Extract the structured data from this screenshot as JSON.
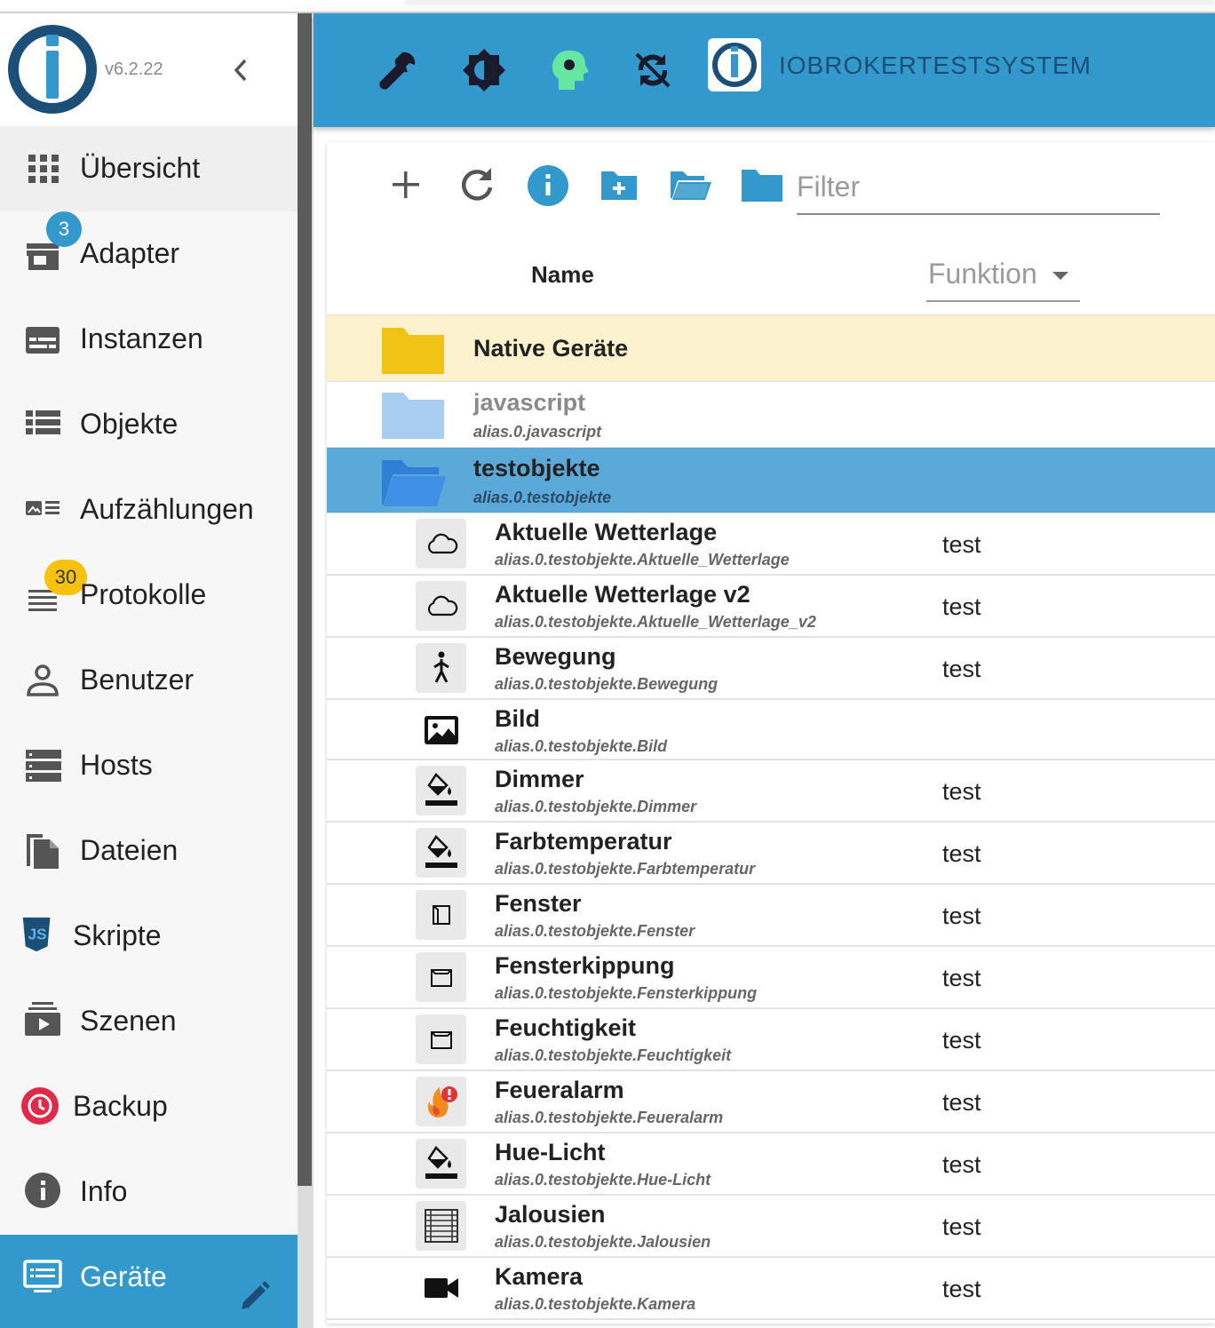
{
  "app": {
    "version": "v6.2.22",
    "hostname": "IOBROKERTESTSYSTEM"
  },
  "sidebar": {
    "items": [
      {
        "label": "Übersicht",
        "icon": "apps-grid-icon"
      },
      {
        "label": "Adapter",
        "icon": "store-icon",
        "badge": "3"
      },
      {
        "label": "Instanzen",
        "icon": "instances-icon"
      },
      {
        "label": "Objekte",
        "icon": "list-icon"
      },
      {
        "label": "Aufzählungen",
        "icon": "enum-icon"
      },
      {
        "label": "Protokolle",
        "icon": "log-lines-icon",
        "badge": "30"
      },
      {
        "label": "Benutzer",
        "icon": "user-icon"
      },
      {
        "label": "Hosts",
        "icon": "hosts-icon"
      },
      {
        "label": "Dateien",
        "icon": "files-icon"
      },
      {
        "label": "Skripte",
        "icon": "js-icon"
      },
      {
        "label": "Szenen",
        "icon": "scenes-icon"
      },
      {
        "label": "Backup",
        "icon": "backup-icon"
      },
      {
        "label": "Info",
        "icon": "info-icon"
      },
      {
        "label": "Geräte",
        "icon": "devices-icon"
      }
    ]
  },
  "toolbar": {
    "filter_placeholder": "Filter"
  },
  "table": {
    "col_name": "Name",
    "col_function": "Funktion"
  },
  "folders": [
    {
      "title": "Native Geräte",
      "subtitle": ""
    },
    {
      "title": "javascript",
      "subtitle": "alias.0.javascript"
    },
    {
      "title": "testobjekte",
      "subtitle": "alias.0.testobjekte"
    }
  ],
  "devices": [
    {
      "name": "Aktuelle Wetterlage",
      "id": "alias.0.testobjekte.Aktuelle_Wetterlage",
      "func": "test",
      "icon": "cloud-icon"
    },
    {
      "name": "Aktuelle Wetterlage v2",
      "id": "alias.0.testobjekte.Aktuelle_Wetterlage_v2",
      "func": "test",
      "icon": "cloud-icon"
    },
    {
      "name": "Bewegung",
      "id": "alias.0.testobjekte.Bewegung",
      "func": "test",
      "icon": "walking-person-icon"
    },
    {
      "name": "Bild",
      "id": "alias.0.testobjekte.Bild",
      "func": "",
      "icon": "image-icon"
    },
    {
      "name": "Dimmer",
      "id": "alias.0.testobjekte.Dimmer",
      "func": "test",
      "icon": "paint-bucket-icon"
    },
    {
      "name": "Farbtemperatur",
      "id": "alias.0.testobjekte.Farbtemperatur",
      "func": "test",
      "icon": "paint-bucket-icon"
    },
    {
      "name": "Fenster",
      "id": "alias.0.testobjekte.Fenster",
      "func": "test",
      "icon": "window-icon"
    },
    {
      "name": "Fensterkippung",
      "id": "alias.0.testobjekte.Fensterkippung",
      "func": "test",
      "icon": "window-tilt-icon"
    },
    {
      "name": "Feuchtigkeit",
      "id": "alias.0.testobjekte.Feuchtigkeit",
      "func": "test",
      "icon": "window-tilt-icon"
    },
    {
      "name": "Feueralarm",
      "id": "alias.0.testobjekte.Feueralarm",
      "func": "test",
      "icon": "fire-alarm-icon"
    },
    {
      "name": "Hue-Licht",
      "id": "alias.0.testobjekte.Hue-Licht",
      "func": "test",
      "icon": "paint-bucket-icon"
    },
    {
      "name": "Jalousien",
      "id": "alias.0.testobjekte.Jalousien",
      "func": "test",
      "icon": "blinds-icon"
    },
    {
      "name": "Kamera",
      "id": "alias.0.testobjekte.Kamera",
      "func": "test",
      "icon": "camera-icon"
    }
  ]
}
